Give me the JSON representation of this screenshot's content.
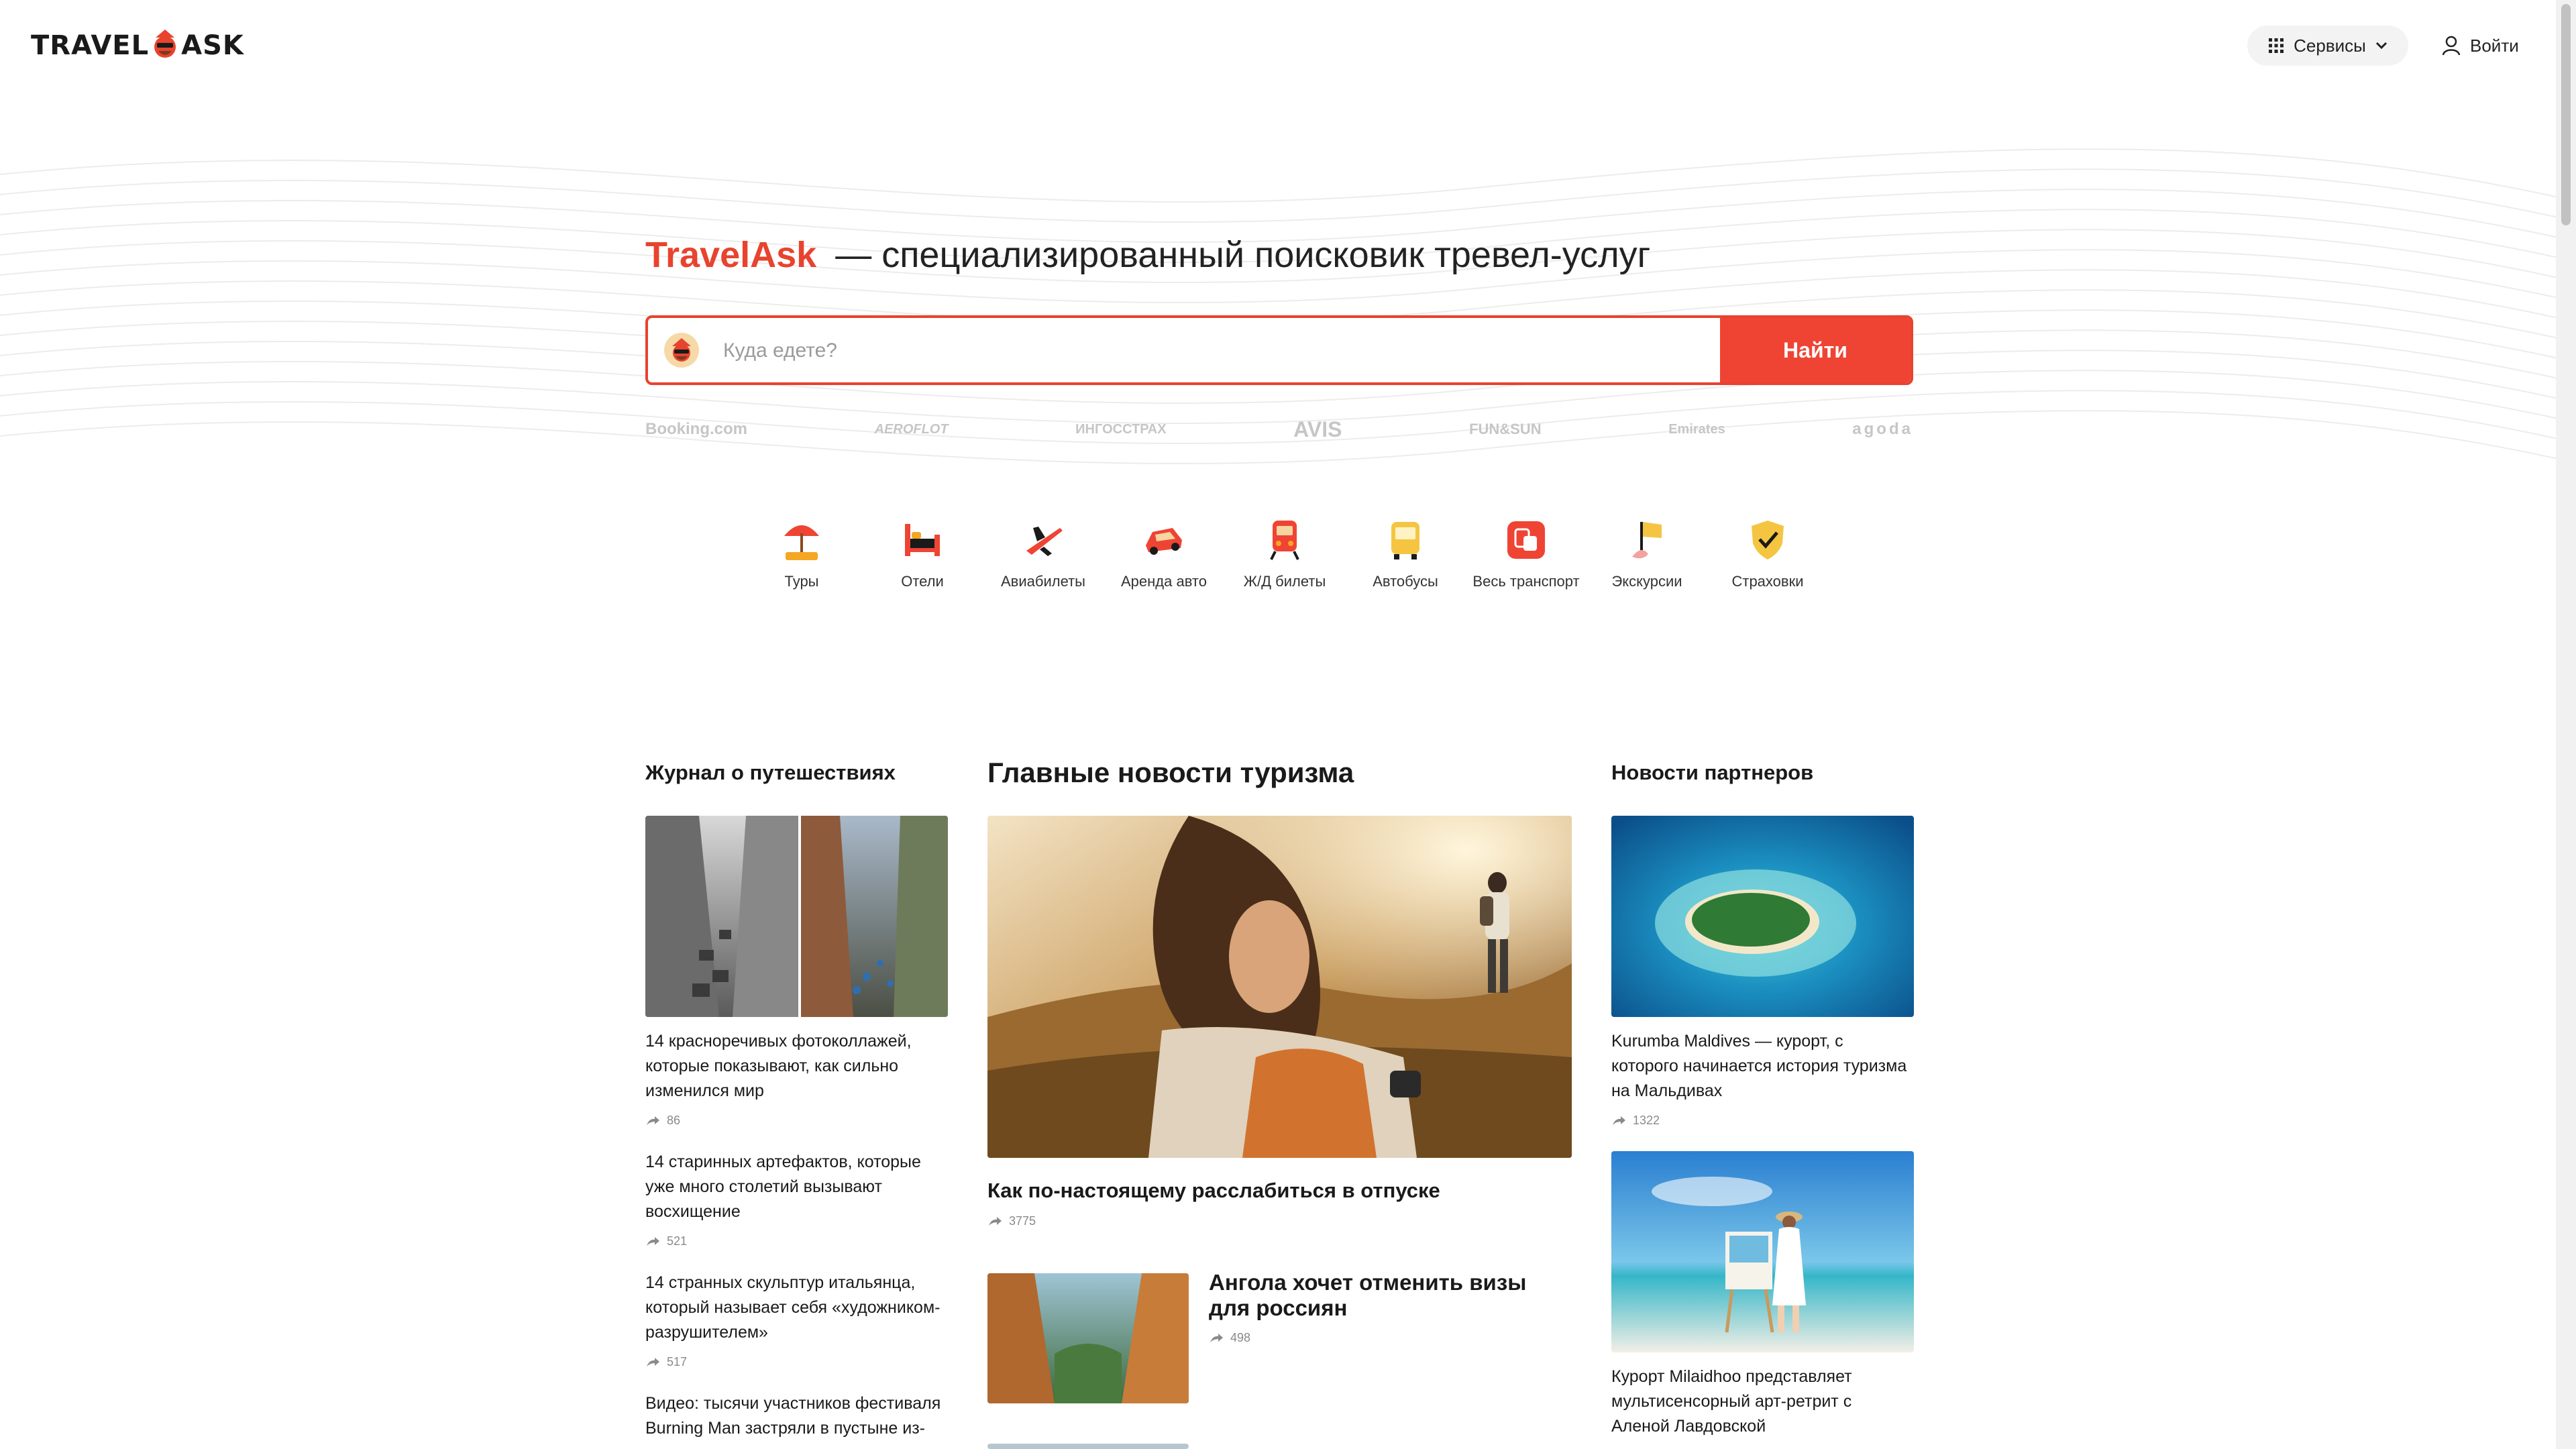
{
  "header": {
    "logo_left": "TRAVEL",
    "logo_right": "ASK",
    "services_label": "Сервисы",
    "login_label": "Войти"
  },
  "hero": {
    "brand": "TravelAsk",
    "tagline": "— специализированный поисковик тревел-услуг",
    "search": {
      "placeholder": "Куда едете?",
      "value": "",
      "button_label": "Найти"
    },
    "partners": [
      "Booking.com",
      "AEROFLOT",
      "ИНГОССТРАХ",
      "AVIS",
      "FUN&SUN",
      "Emirates",
      "agoda"
    ]
  },
  "categories": [
    {
      "label": "Туры",
      "icon": "beach-umbrella-icon"
    },
    {
      "label": "Отели",
      "icon": "bed-icon"
    },
    {
      "label": "Авиабилеты",
      "icon": "airplane-icon"
    },
    {
      "label": "Аренда авто",
      "icon": "car-icon"
    },
    {
      "label": "Ж/Д билеты",
      "icon": "train-icon"
    },
    {
      "label": "Автобусы",
      "icon": "bus-icon"
    },
    {
      "label": "Весь транспорт",
      "icon": "transport-icon"
    },
    {
      "label": "Экскурсии",
      "icon": "flag-icon"
    },
    {
      "label": "Страховки",
      "icon": "shield-check-icon"
    }
  ],
  "journal": {
    "title": "Журнал о путешествиях",
    "items": [
      {
        "title": "14 красноречивых фотоколлажей, которые показывают, как сильно изменился мир",
        "count": "86"
      },
      {
        "title": "14 старинных артефактов, которые уже много столетий вызывают восхищение",
        "count": "521"
      },
      {
        "title": "14 странных скульптур итальянца, который называет себя «художником-разрушителем»",
        "count": "517"
      },
      {
        "title": "Видео: тысячи участников фестиваля Burning Man застряли в пустыне из-",
        "count": ""
      }
    ]
  },
  "news": {
    "title": "Главные новости туризма",
    "main": {
      "title": "Как по-настоящему расслабиться в отпуске",
      "count": "3775"
    },
    "secondary": {
      "title": "Ангола хочет отменить визы для россиян",
      "count": "498"
    }
  },
  "partner_news": {
    "title": "Новости партнеров",
    "items": [
      {
        "title": "Kurumba Maldives — курорт, с которого начинается история туризма на Мальдивах",
        "count": "1322"
      },
      {
        "title": "Курорт Milaidhoo представляет мультисенсорный арт-ретрит с Аленой Лавдовской",
        "count": ""
      }
    ]
  },
  "colors": {
    "accent": "#e8432e",
    "button": "#ef4434",
    "muted": "#8a8a8a"
  }
}
